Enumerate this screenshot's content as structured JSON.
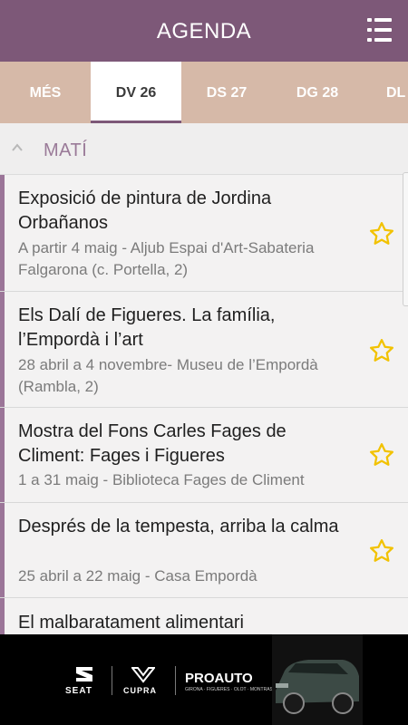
{
  "header": {
    "title": "AGENDA",
    "menu_icon": "menu-list-icon"
  },
  "tabs": [
    {
      "label": "MÉS",
      "active": false
    },
    {
      "label": "DV 26",
      "active": true
    },
    {
      "label": "DS 27",
      "active": false
    },
    {
      "label": "DG 28",
      "active": false
    },
    {
      "label": "DL",
      "active": false
    }
  ],
  "section": {
    "label": "MATÍ",
    "icon": "chevron-up-icon"
  },
  "events": [
    {
      "title": "Exposició de pintura de Jordina Orbañanos",
      "subtitle": "A partir 4 maig - Aljub Espai d'Art-Sabateria Falgarona (c. Portella, 2)"
    },
    {
      "title": "Els Dalí de Figueres. La família, l’Empordà i l’art",
      "subtitle": "28 abril a 4 novembre- Museu de l’Empordà (Rambla, 2)"
    },
    {
      "title": "Mostra del Fons Carles Fages de Climent: Fages i Figueres",
      "subtitle": "1 a 31 maig - Biblioteca Fages de Climent"
    },
    {
      "title": "Després de la tempesta, arriba la calma",
      "subtitle": "25 abril a 22 maig - Casa Empordà"
    },
    {
      "title": "El malbaratament alimentari",
      "subtitle": ""
    }
  ],
  "ad": {
    "brand1": "SEAT",
    "brand2": "CUPRA",
    "brand3": "PROAUTO",
    "tagline": "GIRONA · FIGUERES · OLOT · MONTRAS · EL PALAU"
  },
  "colors": {
    "header": "#7d5878",
    "tabs": "#d6b9a8",
    "accent": "#9b7598",
    "star": "#f2c200"
  }
}
